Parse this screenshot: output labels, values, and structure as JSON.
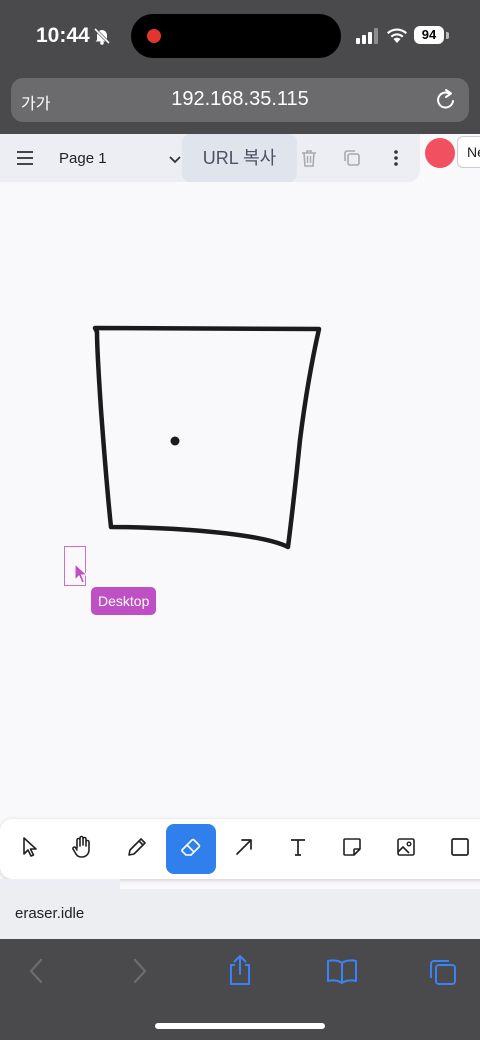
{
  "status_bar": {
    "time": "10:44",
    "battery": "94"
  },
  "safari": {
    "aa_label": "가가",
    "url": "192.168.35.115"
  },
  "app_header": {
    "page_name": "Page 1",
    "copy_url_label": "URL 복사",
    "new_button_label": "Ne",
    "avatar_color": "#f05060"
  },
  "canvas": {
    "collaborator_label": "Desktop",
    "collaborator_color": "#bf4fc4"
  },
  "tools": [
    {
      "name": "select",
      "icon": "pointer-icon",
      "active": false
    },
    {
      "name": "hand",
      "icon": "hand-icon",
      "active": false
    },
    {
      "name": "draw",
      "icon": "pencil-icon",
      "active": false
    },
    {
      "name": "eraser",
      "icon": "eraser-icon",
      "active": true
    },
    {
      "name": "arrow",
      "icon": "arrow-icon",
      "active": false
    },
    {
      "name": "text",
      "icon": "text-icon",
      "active": false
    },
    {
      "name": "note",
      "icon": "note-icon",
      "active": false
    },
    {
      "name": "image",
      "icon": "image-icon",
      "active": false
    },
    {
      "name": "rectangle",
      "icon": "rectangle-icon",
      "active": false
    }
  ],
  "debug": {
    "state": "eraser.idle"
  },
  "colors": {
    "accent": "#2f80ed",
    "safari_chrome": "#4a4a4c",
    "safari_icon": "#3b82f6"
  }
}
